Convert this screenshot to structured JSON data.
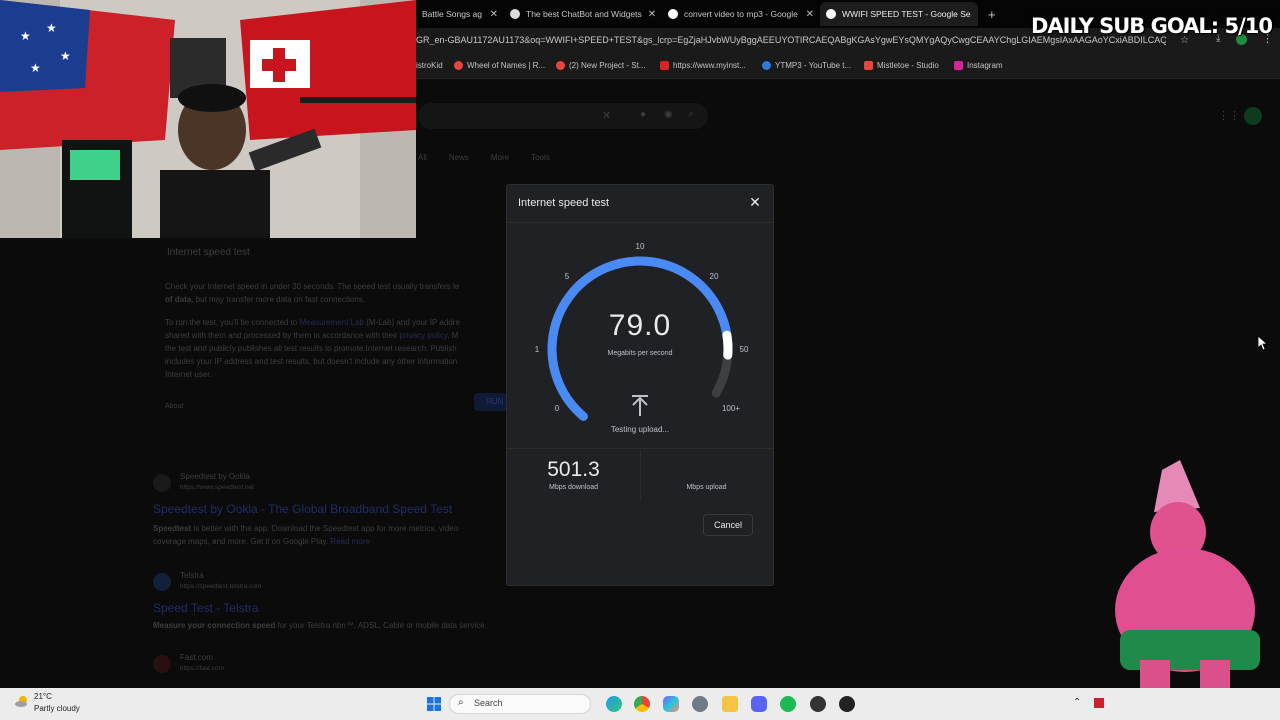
{
  "overlay": {
    "sub_goal": "DAILY SUB GOAL: 5/10"
  },
  "browser": {
    "tabs": [
      {
        "label": "Battle Songs ag",
        "favicon_color": "#8a8a8a",
        "active": false
      },
      {
        "label": "The best ChatBot and Widgets",
        "favicon_color": "#dddddd",
        "active": false
      },
      {
        "label": "convert video to mp3 - Google",
        "favicon_color": "#ffffff",
        "active": false
      },
      {
        "label": "WWIFI SPEED TEST - Google Se",
        "favicon_color": "#ffffff",
        "active": true
      }
    ],
    "new_tab_symbol": "+",
    "url": "GR_en-GBAU1172AU1173&oq=WWIFI+SPEED+TEST&gs_lcrp=EgZjaHJvbWUyBggAEEUYOTIRCAEQABgKGAsYgwEYsQMYgAQyCwgCEAAYChgLGIAEMgsIAxAAGAoYCxiABDILCAQQABgKGAsYgAQ",
    "bookmarks": [
      {
        "label": "istroKid",
        "color": "#555555"
      },
      {
        "label": "Wheel of Names | R...",
        "color": "#e8453c"
      },
      {
        "label": "(2) New Project - St...",
        "color": "#e8453c"
      },
      {
        "label": "https://www.myinst...",
        "color": "#d9261c"
      },
      {
        "label": "YTMP3 - YouTube t...",
        "color": "#2b7be0"
      },
      {
        "label": "Mistletoe - Studio",
        "color": "#e8453c"
      },
      {
        "label": "Instagram",
        "color": "#d6249f"
      }
    ]
  },
  "page": {
    "section_title": "Internet speed test",
    "intro_line1": "Check your Internet speed in under 30 seconds. The speed test usually transfers le",
    "intro_line2_bold": "of data",
    "intro_line2_rest": ", but may transfer more data on fast connections.",
    "para2_line1_a": "To run the test, you'll be connected to ",
    "para2_link1": "Measurement Lab",
    "para2_line1_b": " (M-Lab) and your IP addre",
    "para2_line2_a": "shared with them and processed by them in accordance with their ",
    "para2_link2": "privacy policy",
    "para2_line2_b": ". M",
    "para2_line3": "the test and publicly publishes all test results to promote Internet research. Publish",
    "para2_line4": "includes your IP address and test results, but doesn't include any other information",
    "para2_line5": "Internet user.",
    "about_link": "About",
    "run_button": "RUN",
    "nav_tabs": [
      "All",
      "News",
      "More",
      "Tools"
    ],
    "results": [
      {
        "source": "Speedtest by Ookla",
        "url": "https://www.speedtest.net",
        "title": "Speedtest by Ookla - The Global Broadband Speed Test",
        "snippet_bold": "Speedtest",
        "snippet": " is better with the app. Download the Speedtest app for more metrics, video",
        "snippet2": "coverage maps, and more. Get it on Google Play.",
        "read_more": "Read more"
      },
      {
        "source": "Telstra",
        "url": "https://speedtest.telstra.com",
        "title": "Speed Test - Telstra",
        "snippet_bold": "Measure your connection speed",
        "snippet": " for your Telstra nbn™, ADSL, Cable or mobile data service.",
        "snippet2": "",
        "read_more": ""
      },
      {
        "source": "Fast.com",
        "url": "https://fast.com",
        "title": "",
        "snippet_bold": "",
        "snippet": "",
        "snippet2": "",
        "read_more": ""
      }
    ]
  },
  "dialog": {
    "title": "Internet speed test",
    "close_symbol": "✕",
    "gauge_ticks": [
      "0",
      "1",
      "5",
      "10",
      "20",
      "50",
      "100+"
    ],
    "gauge_fill_fraction": 0.9,
    "speed_value": "79.0",
    "speed_unit": "Megabits per second",
    "status": "Testing upload...",
    "download_value": "501.3",
    "download_label": "Mbps download",
    "upload_label": "Mbps upload",
    "cancel_label": "Cancel",
    "accent_color": "#4a8af4"
  },
  "taskbar": {
    "weather_temp": "21°C",
    "weather_desc": "Partly cloudy",
    "search_label": "Search",
    "apps": [
      "windows-start",
      "search",
      "widgets",
      "edge",
      "chrome",
      "copilot",
      "settings",
      "file-explorer",
      "discord",
      "spotify",
      "media",
      "obs"
    ]
  }
}
